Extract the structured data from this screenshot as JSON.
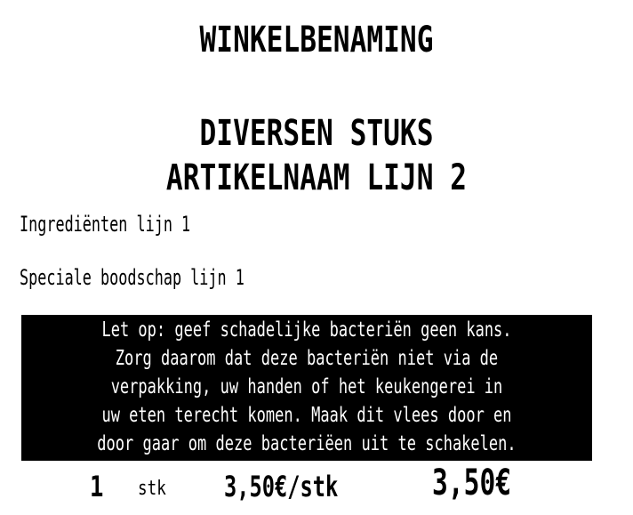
{
  "label": {
    "shop_name": "WINKELBENAMING",
    "title_line1": "DIVERSEN STUKS",
    "title_line2": "ARTIKELNAAM LIJN 2",
    "ingredients": "Ingrediënten lijn 1",
    "special_message": "Speciale boodschap lijn 1",
    "warning_lines": [
      "Let op: geef schadelijke bacteriën geen kans.",
      "Zorg daarom dat deze bacteriën niet via de",
      "verpakking, uw handen of het keukengerei in",
      "uw eten terecht komen. Maak dit vlees door en",
      "door gaar om deze bacteriëen uit te schakelen."
    ],
    "quantity": "1",
    "quantity_unit": "stk",
    "unit_price": "3,50€/stk",
    "total_price": "3,50€"
  }
}
